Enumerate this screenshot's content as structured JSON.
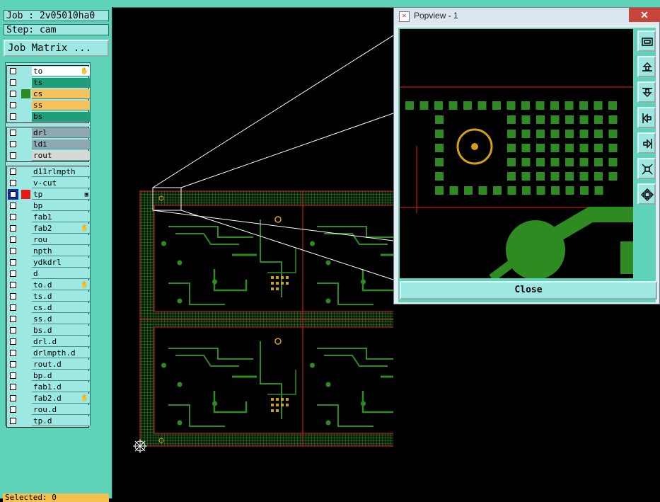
{
  "job": {
    "label": "Job : 2v05010ha0"
  },
  "step": {
    "label": "Step: cam"
  },
  "job_matrix_button": "Job Matrix ...",
  "layer_groups": [
    {
      "rows": [
        {
          "name": "to",
          "bg": "#ffffff",
          "swatch": "",
          "mark": "✋"
        },
        {
          "name": "ts",
          "bg": "#1f9e7a",
          "swatch": "",
          "mark": ""
        },
        {
          "name": "cs",
          "bg": "#f7c25a",
          "swatch": "#2e8b22",
          "mark": ""
        },
        {
          "name": "ss",
          "bg": "#f7c25a",
          "swatch": "",
          "mark": ""
        },
        {
          "name": "bs",
          "bg": "#1f9e7a",
          "swatch": "",
          "mark": ""
        }
      ]
    },
    {
      "rows": [
        {
          "name": "drl",
          "bg": "#8fa8b2",
          "swatch": "",
          "mark": ""
        },
        {
          "name": "ldi",
          "bg": "#8fa8b2",
          "swatch": "",
          "mark": ""
        },
        {
          "name": "rout",
          "bg": "#d8d8d8",
          "swatch": "",
          "mark": ""
        }
      ]
    },
    {
      "rows": [
        {
          "name": "d11rlmpth",
          "bg": "#9ee8e4",
          "swatch": "",
          "mark": ""
        },
        {
          "name": "v-cut",
          "bg": "#9ee8e4",
          "swatch": "",
          "mark": ""
        },
        {
          "name": "tp",
          "bg": "#9ee8e4",
          "swatch": "#e81818",
          "mark": "▣",
          "selected": true
        },
        {
          "name": "bp",
          "bg": "#9ee8e4",
          "swatch": "",
          "mark": ""
        },
        {
          "name": "fab1",
          "bg": "#9ee8e4",
          "swatch": "",
          "mark": ""
        },
        {
          "name": "fab2",
          "bg": "#9ee8e4",
          "swatch": "",
          "mark": "✋"
        },
        {
          "name": "rou",
          "bg": "#9ee8e4",
          "swatch": "",
          "mark": ""
        },
        {
          "name": "npth",
          "bg": "#9ee8e4",
          "swatch": "",
          "mark": ""
        },
        {
          "name": "ydkdrl",
          "bg": "#9ee8e4",
          "swatch": "",
          "mark": ""
        },
        {
          "name": "d",
          "bg": "#9ee8e4",
          "swatch": "",
          "mark": ""
        },
        {
          "name": "to.d",
          "bg": "#9ee8e4",
          "swatch": "",
          "mark": "✋"
        },
        {
          "name": "ts.d",
          "bg": "#9ee8e4",
          "swatch": "",
          "mark": ""
        },
        {
          "name": "cs.d",
          "bg": "#9ee8e4",
          "swatch": "",
          "mark": ""
        },
        {
          "name": "ss.d",
          "bg": "#9ee8e4",
          "swatch": "",
          "mark": ""
        },
        {
          "name": "bs.d",
          "bg": "#9ee8e4",
          "swatch": "",
          "mark": ""
        },
        {
          "name": "drl.d",
          "bg": "#9ee8e4",
          "swatch": "",
          "mark": ""
        },
        {
          "name": "drlmpth.d",
          "bg": "#9ee8e4",
          "swatch": "",
          "mark": ""
        },
        {
          "name": "rout.d",
          "bg": "#9ee8e4",
          "swatch": "",
          "mark": ""
        },
        {
          "name": "bp.d",
          "bg": "#9ee8e4",
          "swatch": "",
          "mark": ""
        },
        {
          "name": "fab1.d",
          "bg": "#9ee8e4",
          "swatch": "",
          "mark": ""
        },
        {
          "name": "fab2.d",
          "bg": "#9ee8e4",
          "swatch": "",
          "mark": "✋"
        },
        {
          "name": "rou.d",
          "bg": "#9ee8e4",
          "swatch": "",
          "mark": ""
        },
        {
          "name": "tp.d",
          "bg": "#9ee8e4",
          "swatch": "",
          "mark": ""
        }
      ]
    }
  ],
  "status_bar": {
    "text": "Selected: 0"
  },
  "popup": {
    "title": "Popview - 1",
    "close_x": "✕",
    "close_button": "Close",
    "tools": [
      "zoom-fit-icon",
      "pan-up-icon",
      "pan-down-icon",
      "pan-left-icon",
      "pan-right-icon",
      "zoom-in-icon",
      "zoom-out-icon"
    ]
  },
  "colors": {
    "panel": "#5fd3b8",
    "copper": "#2e8b22",
    "outline": "#e02020",
    "pad_ring": "#d4a017"
  }
}
